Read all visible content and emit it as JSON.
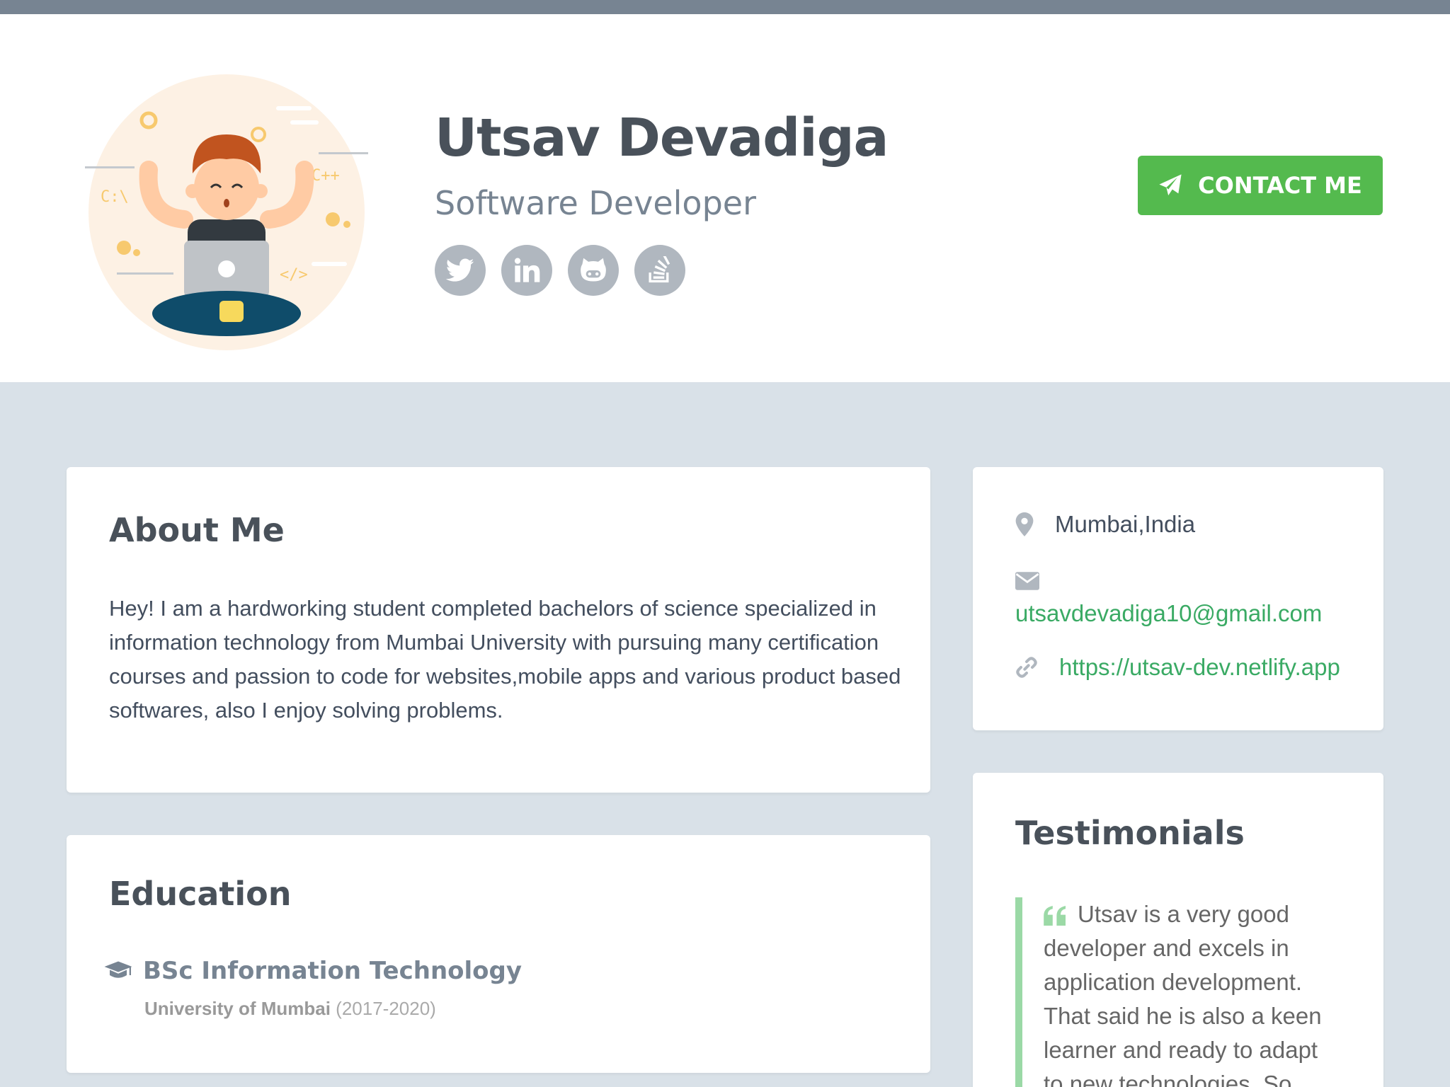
{
  "header": {
    "name": "Utsav Devadiga",
    "role": "Software Developer",
    "contact_label": "CONTACT ME",
    "social": [
      {
        "icon": "twitter-icon"
      },
      {
        "icon": "linkedin-icon"
      },
      {
        "icon": "github-icon"
      },
      {
        "icon": "stackoverflow-icon"
      }
    ]
  },
  "about": {
    "title": "About Me",
    "text": "Hey! I am a hardworking student completed bachelors of science specialized in information technology from Mumbai University with pursuing many certification courses and passion to code for websites,mobile apps and various product based softwares, also I enjoy solving problems."
  },
  "education": {
    "title": "Education",
    "degree": "BSc Information Technology",
    "university": "University of Mumbai",
    "years": "(2017-2020)"
  },
  "info": {
    "location": "Mumbai,India",
    "email": "utsavdevadiga10@gmail.com",
    "website": "https://utsav-dev.netlify.app"
  },
  "testimonials": {
    "title": "Testimonials",
    "quote": "Utsav is a very good developer and excels in application development. That said he is also a keen learner and ready to adapt to new technologies. So..."
  },
  "colors": {
    "accent_green": "#54ba4e",
    "link_green": "#3aaa64",
    "topbar": "#778492",
    "background": "#d9e1e8"
  }
}
